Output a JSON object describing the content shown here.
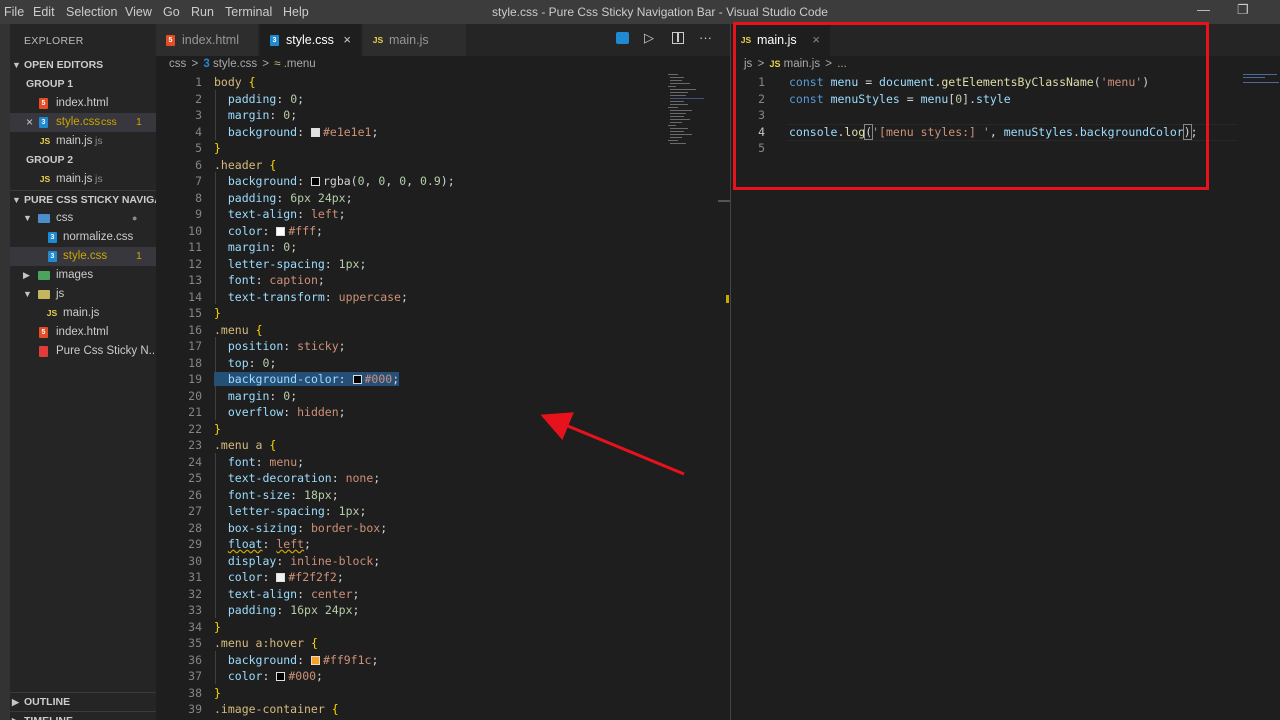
{
  "menu": [
    "File",
    "Edit",
    "Selection",
    "View",
    "Go",
    "Run",
    "Terminal",
    "Help"
  ],
  "window_title": "style.css - Pure Css Sticky Navigation Bar - Visual Studio Code",
  "sidebar": {
    "header": "EXPLORER",
    "open_editors": "OPEN EDITORS",
    "group1": "GROUP 1",
    "group2": "GROUP 2",
    "g1_items": [
      {
        "name": "index.html",
        "icon": "html-file-icon"
      },
      {
        "name": "style.css",
        "hint": "css",
        "badge": "1",
        "icon": "css-file-icon"
      },
      {
        "name": "main.js",
        "hint": "js",
        "icon": "js-file-icon"
      }
    ],
    "g2_items": [
      {
        "name": "main.js",
        "hint": "js",
        "icon": "js-file-icon"
      }
    ],
    "project": "PURE CSS STICKY NAVIGA...",
    "tree": [
      {
        "name": "css",
        "type": "folder"
      },
      {
        "name": "normalize.css",
        "type": "css"
      },
      {
        "name": "style.css",
        "type": "css",
        "badge": "1"
      },
      {
        "name": "images",
        "type": "folder"
      },
      {
        "name": "js",
        "type": "folder"
      },
      {
        "name": "main.js",
        "type": "js"
      },
      {
        "name": "index.html",
        "type": "html"
      },
      {
        "name": "Pure Css Sticky N...",
        "type": "pdf"
      }
    ],
    "outline": "OUTLINE",
    "timeline": "TIMELINE"
  },
  "editor1": {
    "tabs": [
      {
        "label": "index.html"
      },
      {
        "label": "style.css",
        "close": "×"
      },
      {
        "label": "main.js"
      }
    ],
    "breadcrumb": [
      "css",
      ">",
      "style.css",
      ">",
      ".menu"
    ],
    "line_numbers": [
      "1",
      "2",
      "3",
      "4",
      "5",
      "6",
      "7",
      "8",
      "9",
      "10",
      "11",
      "12",
      "13",
      "14",
      "15",
      "16",
      "17",
      "18",
      "19",
      "20",
      "21",
      "22",
      "23",
      "24",
      "25",
      "26",
      "27",
      "28",
      "29",
      "30",
      "31",
      "32",
      "33",
      "34",
      "35",
      "36",
      "37",
      "38",
      "39"
    ]
  },
  "editor2": {
    "tab": "main.js",
    "tab_close": "×",
    "breadcrumb": [
      "js",
      ">",
      "main.js",
      ">",
      "..."
    ],
    "line_numbers": [
      "1",
      "2",
      "3",
      "4",
      "5"
    ]
  },
  "colors": {
    "annotation": "#e8121d",
    "accent": "#007acc"
  }
}
